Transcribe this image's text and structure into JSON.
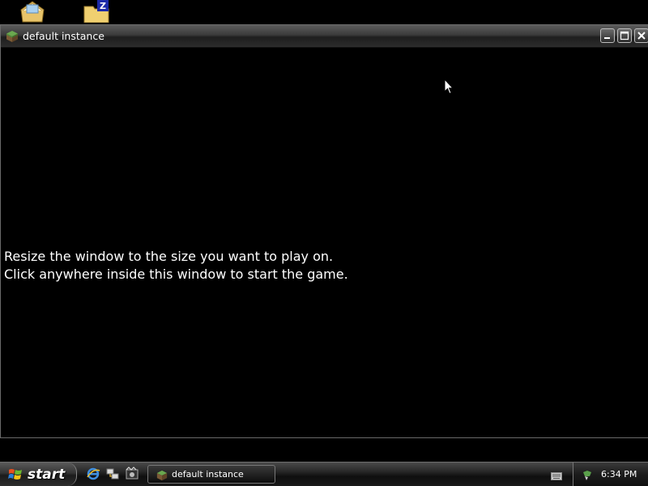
{
  "desktop": {
    "icons": [
      {
        "name": "mail-icon"
      },
      {
        "name": "zip-folder-icon",
        "badge": "Z"
      }
    ]
  },
  "window": {
    "title": "default instance",
    "icon": "grass-block-icon",
    "buttons": [
      "minimize-icon",
      "maximize-icon",
      "close-icon"
    ],
    "message_line1": "Resize the window to the size you want to play on.",
    "message_line2": "Click anywhere inside this window to start the game."
  },
  "taskbar": {
    "start_label": "start",
    "quick_launch": [
      "internet-explorer-icon",
      "network-icon",
      "media-icon"
    ],
    "task_item_label": "default instance",
    "clock": "6:34 PM"
  },
  "colors": {
    "background": "#000000",
    "text": "#ffffff",
    "titlebar": "#2c2c2c"
  }
}
